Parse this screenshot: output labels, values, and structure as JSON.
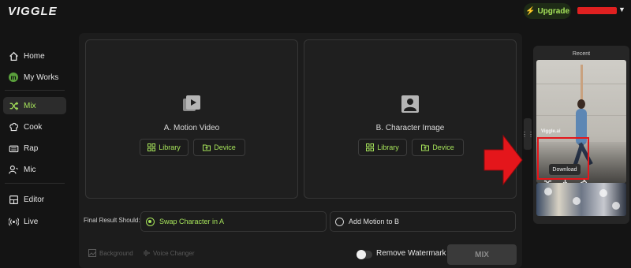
{
  "app": {
    "logo": "VIGGLE"
  },
  "header": {
    "upgrade_label": "Upgrade",
    "username_redacted": true
  },
  "sidebar": {
    "items": [
      {
        "label": "Home",
        "icon": "home-icon",
        "active": false
      },
      {
        "label": "My Works",
        "icon": "my-works-avatar",
        "active": false
      },
      {
        "label": "Mix",
        "icon": "shuffle-icon",
        "active": true
      },
      {
        "label": "Cook",
        "icon": "chef-hat-icon",
        "active": false
      },
      {
        "label": "Rap",
        "icon": "keyboard-icon",
        "active": false
      },
      {
        "label": "Mic",
        "icon": "mic-user-icon",
        "active": false
      },
      {
        "label": "Editor",
        "icon": "editor-icon",
        "active": false
      },
      {
        "label": "Live",
        "icon": "broadcast-icon",
        "active": false
      }
    ],
    "my_works_initial": "m"
  },
  "main": {
    "motion_video": {
      "title": "A. Motion Video",
      "library_label": "Library",
      "device_label": "Device"
    },
    "character_image": {
      "title": "B. Character Image",
      "library_label": "Library",
      "device_label": "Device"
    },
    "final_result": {
      "label": "Final Result Should:",
      "options": [
        {
          "label": "Swap Character in A",
          "selected": true
        },
        {
          "label": "Add Motion to B",
          "selected": false
        }
      ]
    },
    "tools": {
      "background_label": "Background",
      "voice_changer_label": "Voice Changer"
    },
    "watermark": {
      "label": "Remove Watermark",
      "enabled": false
    },
    "mix_button_label": "MIX"
  },
  "recent": {
    "title": "Recent",
    "thumb_logo": "Viggle.ai",
    "tooltip": "Download"
  },
  "colors": {
    "accent": "#a6e35a",
    "background": "#141414",
    "panel": "#1c1c1c",
    "highlight": "#e4161b"
  }
}
